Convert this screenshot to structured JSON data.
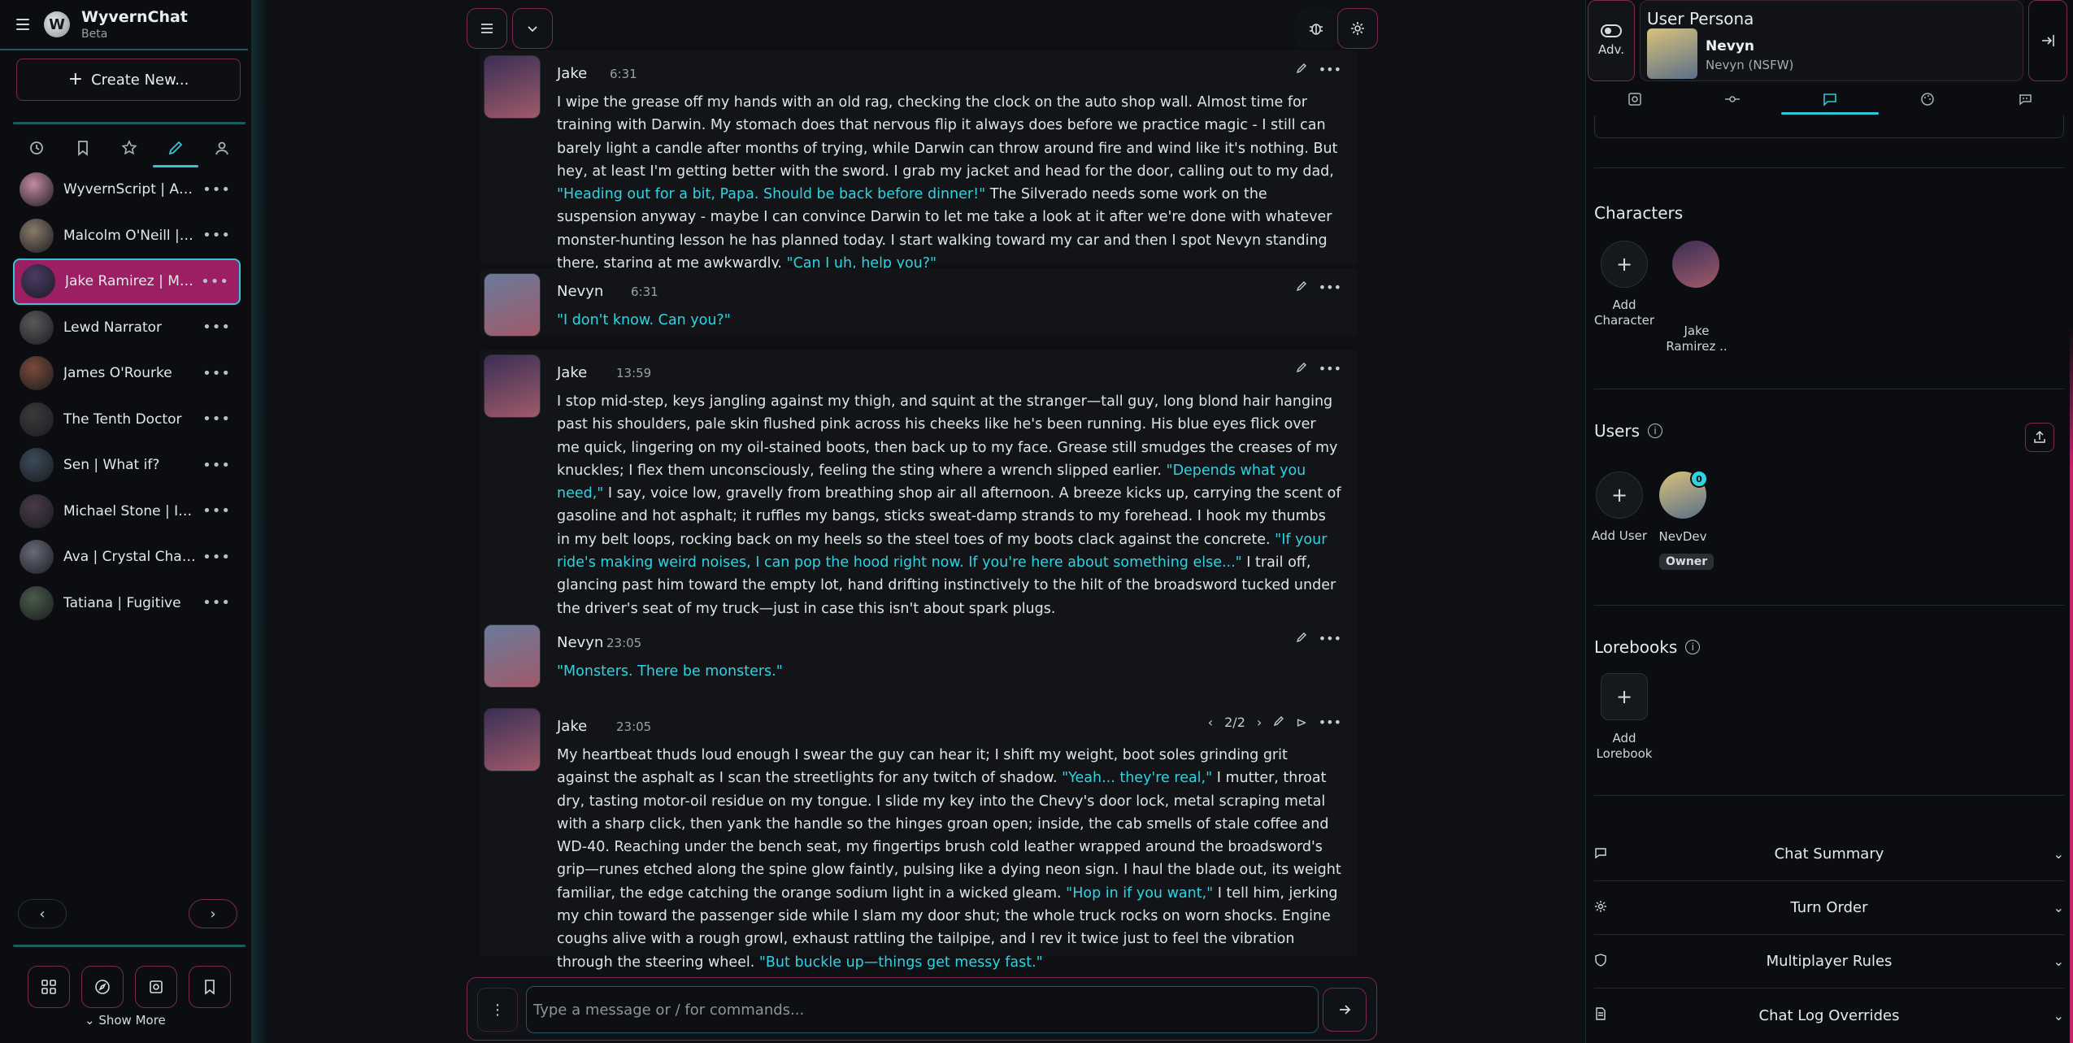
{
  "brand": {
    "title": "WyvernChat",
    "subtitle": "Beta"
  },
  "sidebar": {
    "create_label": "Create New...",
    "tabs": [
      "history-icon",
      "bookmark-icon",
      "star-icon",
      "pencil-icon",
      "users-icon"
    ],
    "characters": [
      {
        "name": "WyvernScript | Ass...",
        "color": "#c58aa0"
      },
      {
        "name": "Malcolm O'Neill | B...",
        "color": "#8a7a6a"
      },
      {
        "name": "Jake Ramirez | Mo...",
        "color": "#4a3a66",
        "active": true
      },
      {
        "name": "Lewd Narrator",
        "color": "#5a5a5a"
      },
      {
        "name": "James O'Rourke",
        "color": "#7a4a3a"
      },
      {
        "name": "The Tenth Doctor",
        "color": "#3a3a3a"
      },
      {
        "name": "Sen | What if?",
        "color": "#3a4a5a"
      },
      {
        "name": "Michael Stone | Inv...",
        "color": "#4a3a4a"
      },
      {
        "name": "Ava | Crystal Chaser",
        "color": "#6a6a7a"
      },
      {
        "name": "Tatiana | Fugitive",
        "color": "#4a5a4a"
      }
    ],
    "show_more": "Show More"
  },
  "chat": {
    "messages": [
      {
        "name": "Jake",
        "time": "6:31",
        "segments": [
          {
            "t": "I wipe the grease off my hands with an old rag, checking the clock on the auto shop wall. Almost time for training with Darwin. My stomach does that nervous flip it always does before we practice magic - I still can barely light a candle after months of trying, while Darwin can throw around fire and wind like it's nothing. But hey, at least I'm getting better with the sword. I grab my jacket and head for the door, calling out to my dad, "
          },
          {
            "t": "\"Heading out for a bit, Papa. Should be back before dinner!\"",
            "q": true
          },
          {
            "t": " The Silverado needs some work on the suspension anyway - maybe I can convince Darwin to let me take a look at it after we're done with whatever monster-hunting lesson he has planned today. I start walking toward my car and then I spot Nevyn standing there, staring at me awkwardly. "
          },
          {
            "t": "\"Can I uh, help you?\"",
            "q": true
          }
        ]
      },
      {
        "name": "Nevyn",
        "time": "6:31",
        "segments": [
          {
            "t": "\"I don't know. Can you?\"",
            "q": true
          }
        ]
      },
      {
        "name": "Jake",
        "time": "13:59",
        "segments": [
          {
            "t": "I stop mid-step, keys jangling against my thigh, and squint at the stranger—tall guy, long blond hair hanging past his shoulders, pale skin flushed pink across his cheeks like he's been running. His blue eyes flick over me quick, lingering on my oil-stained boots, then back up to my face. Grease still smudges the creases of my knuckles; I flex them unconsciously, feeling the sting where a wrench slipped earlier. "
          },
          {
            "t": "\"Depends what you need,\"",
            "q": true
          },
          {
            "t": " I say, voice low, gravelly from breathing shop air all afternoon. A breeze kicks up, carrying the scent of gasoline and hot asphalt; it ruffles my bangs, sticks sweat-damp strands to my forehead. I hook my thumbs in my belt loops, rocking back on my heels so the steel toes of my boots clack against the concrete. "
          },
          {
            "t": "\"If your ride's making weird noises, I can pop the hood right now. If you're here about something else...\"",
            "q": true
          },
          {
            "t": " I trail off, glancing past him toward the empty lot, hand drifting instinctively to the hilt of the broadsword tucked under the driver's seat of my truck—just in case this isn't about spark plugs."
          }
        ]
      },
      {
        "name": "Nevyn",
        "time": "23:05",
        "segments": [
          {
            "t": "\"Monsters. There be monsters.\"",
            "q": true
          }
        ]
      },
      {
        "name": "Jake",
        "time": "23:05",
        "swipe": "2/2",
        "segments": [
          {
            "t": "My heartbeat thuds loud enough I swear the guy can hear it; I shift my weight, boot soles grinding grit against the asphalt as I scan the streetlights for any twitch of shadow. "
          },
          {
            "t": "\"Yeah... they're real,\"",
            "q": true
          },
          {
            "t": " I mutter, throat dry, tasting motor-oil residue on my tongue. I slide my key into the Chevy's door lock, metal scraping metal with a sharp click, then yank the handle so the hinges groan open; inside, the cab smells of stale coffee and WD-40. Reaching under the bench seat, my fingertips brush cold leather wrapped around the broadsword's grip—runes etched along the spine glow faintly, pulsing like a dying neon sign. I haul the blade out, its weight familiar, the edge catching the orange sodium light in a wicked gleam. "
          },
          {
            "t": "\"Hop in if you want,\"",
            "q": true
          },
          {
            "t": " I tell him, jerking my chin toward the passenger side while I slam my door shut; the whole truck rocks on worn shocks. Engine coughs alive with a rough growl, exhaust rattling the tailpipe, and I rev it twice just to feel the vibration through the steering wheel. "
          },
          {
            "t": "\"But buckle up—things get messy fast.\"",
            "q": true
          }
        ]
      }
    ],
    "composer_placeholder": "Type a message or / for commands..."
  },
  "right": {
    "adv_label": "Adv.",
    "persona_title": "User Persona",
    "persona_name": "Nevyn",
    "persona_desc": "Nevyn (NSFW)",
    "characters_title": "Characters",
    "add_character": "Add Character",
    "character_name": "Jake Ramirez ..",
    "users_title": "Users",
    "add_user": "Add User",
    "user_name": "NevDev",
    "owner_badge": "Owner",
    "lorebooks_title": "Lorebooks",
    "add_lorebook": "Add Lorebook",
    "accordions": [
      "Chat Summary",
      "Turn Order",
      "Multiplayer Rules",
      "Chat Log Overrides"
    ]
  },
  "colors": {
    "accent_teal": "#2fc6d6",
    "accent_magenta": "#9c1e63",
    "quote": "#2fd4e2"
  }
}
